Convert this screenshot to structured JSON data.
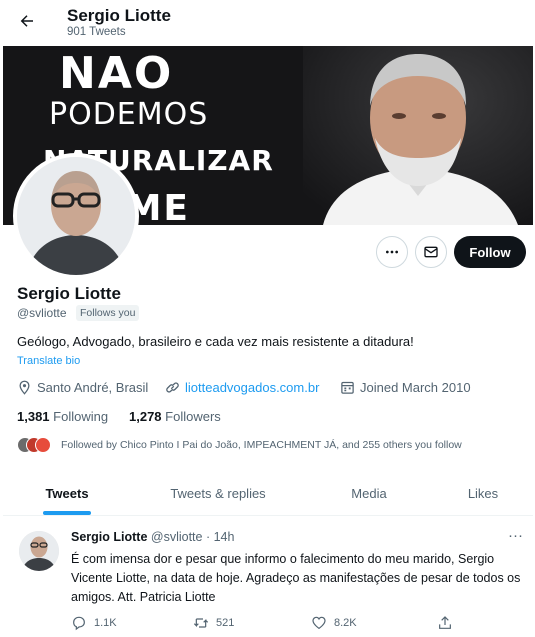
{
  "header": {
    "name": "Sergio Liotte",
    "tweet_count": "901 Tweets"
  },
  "banner": {
    "line1": "NAO",
    "line2": "PODEMOS",
    "line3": "NATURALIZAR",
    "line4": "OME"
  },
  "profile": {
    "name": "Sergio Liotte",
    "handle": "@svliotte",
    "follows_you": "Follows you",
    "bio": "Geólogo, Advogado, brasileiro e cada vez mais resistente a ditadura!",
    "translate": "Translate bio",
    "location": "Santo André, Brasil",
    "website": "liotteadvogados.com.br",
    "joined": "Joined March 2010",
    "following_count": "1,381",
    "following_label": "Following",
    "followers_count": "1,278",
    "followers_label": "Followers",
    "mutuals_text": "Followed by Chico Pinto I Pai do João, IMPEACHMENT JÁ, and 255 others you follow",
    "follow_button": "Follow"
  },
  "tabs": [
    {
      "label": "Tweets",
      "active": true
    },
    {
      "label": "Tweets & replies",
      "active": false
    },
    {
      "label": "Media",
      "active": false
    },
    {
      "label": "Likes",
      "active": false
    }
  ],
  "tweet": {
    "name": "Sergio Liotte",
    "handle_time": "@svliotte · 14h",
    "text": "É com imensa dor e pesar que informo o falecimento do meu marido, Sergio Vicente Liotte, na data de hoje. Agradeço as manifestações de pesar de todos os amigos. Att. Patricia Liotte",
    "replies": "1.1K",
    "retweets": "521",
    "likes": "8.2K"
  },
  "colors": {
    "accent": "#1d9bf0",
    "text": "#0f1419",
    "muted": "#536471",
    "follow_bg": "#0f1419"
  },
  "icons": [
    "back-arrow-icon",
    "more-icon",
    "mail-icon",
    "location-icon",
    "link-icon",
    "calendar-icon",
    "reply-icon",
    "retweet-icon",
    "like-icon",
    "share-icon"
  ]
}
